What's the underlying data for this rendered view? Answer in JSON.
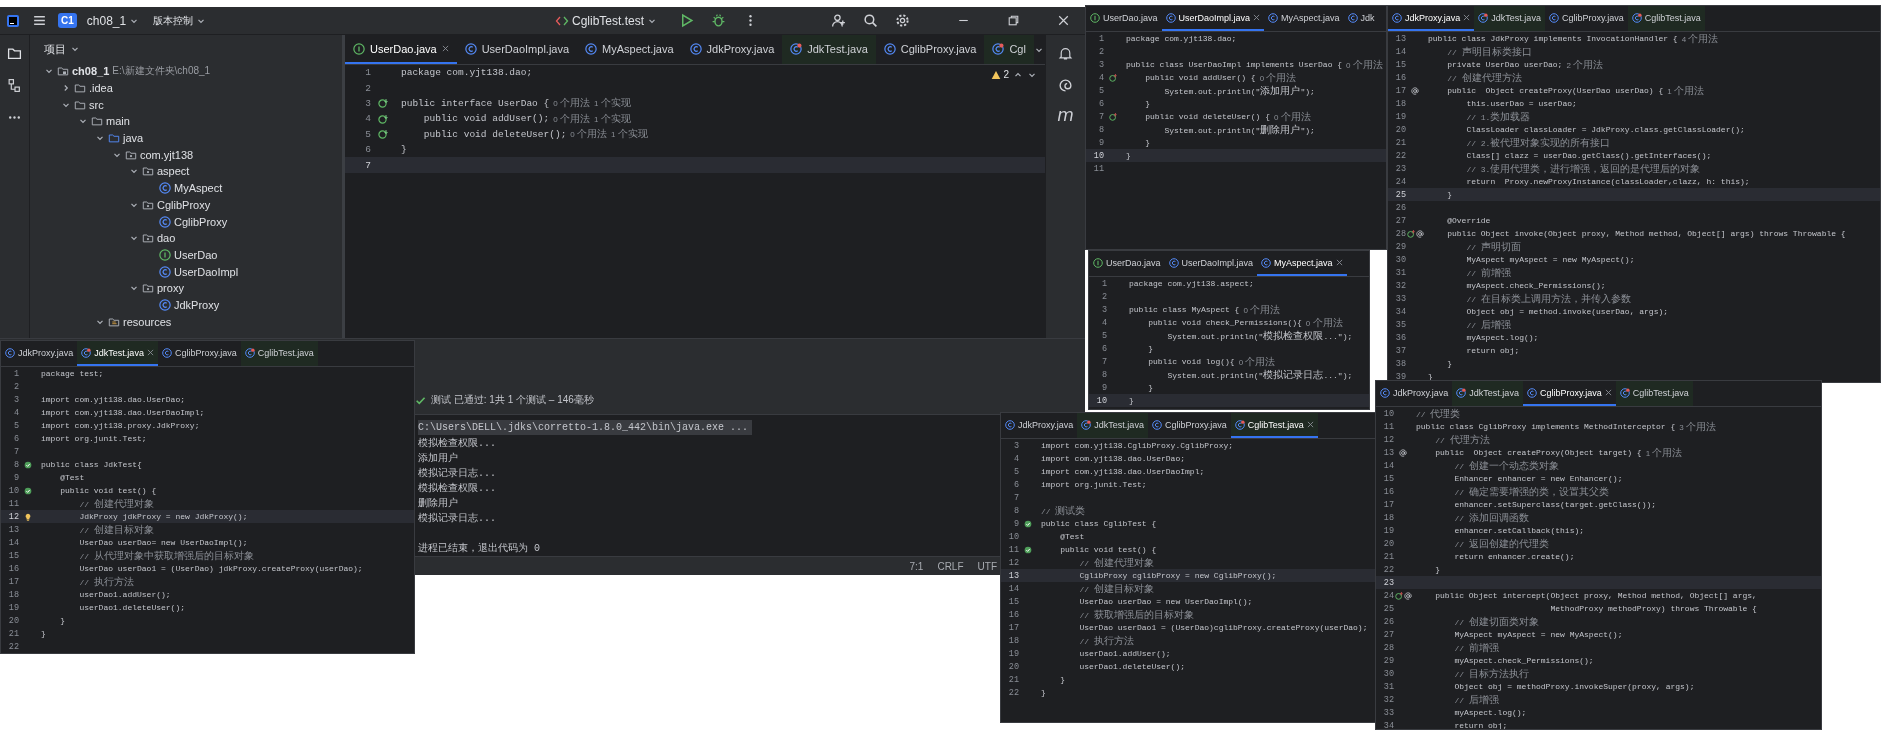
{
  "main_window": {
    "title_bar": {
      "project_badge": "C1",
      "project": "ch08_1",
      "vcs": "版本控制",
      "run_config": "CglibTest.test"
    },
    "project_panel": {
      "title": "项目",
      "tree": [
        {
          "label": "ch08_1",
          "path": "E:\\新建文件夹\\ch08_1",
          "kind": "module",
          "expanded": true,
          "children": [
            {
              "label": ".idea",
              "kind": "folder",
              "expanded": false
            },
            {
              "label": "src",
              "kind": "folder",
              "expanded": true,
              "children": [
                {
                  "label": "main",
                  "kind": "folder",
                  "expanded": true,
                  "children": [
                    {
                      "label": "java",
                      "kind": "source",
                      "expanded": true,
                      "children": [
                        {
                          "label": "com.yjt138",
                          "kind": "package",
                          "expanded": true,
                          "children": [
                            {
                              "label": "aspect",
                              "kind": "package",
                              "expanded": true,
                              "children": [
                                {
                                  "label": "MyAspect",
                                  "kind": "class"
                                }
                              ]
                            },
                            {
                              "label": "CglibProxy",
                              "kind": "package",
                              "expanded": true,
                              "children": [
                                {
                                  "label": "CglibProxy",
                                  "kind": "class"
                                }
                              ]
                            },
                            {
                              "label": "dao",
                              "kind": "package",
                              "expanded": true,
                              "children": [
                                {
                                  "label": "UserDao",
                                  "kind": "interface"
                                },
                                {
                                  "label": "UserDaoImpl",
                                  "kind": "class"
                                }
                              ]
                            },
                            {
                              "label": "proxy",
                              "kind": "package",
                              "expanded": true,
                              "children": [
                                {
                                  "label": "JdkProxy",
                                  "kind": "class"
                                }
                              ]
                            }
                          ]
                        }
                      ]
                    },
                    {
                      "label": "resources",
                      "kind": "resources",
                      "expanded": true
                    }
                  ]
                }
              ]
            }
          ]
        }
      ]
    },
    "editor": {
      "warnings": "2",
      "tabs": [
        {
          "label": "UserDao.java",
          "kind": "interface",
          "selected": true
        },
        {
          "label": "UserDaoImpl.java",
          "kind": "class",
          "selected": false
        },
        {
          "label": "MyAspect.java",
          "kind": "class",
          "selected": false
        },
        {
          "label": "JdkProxy.java",
          "kind": "class",
          "selected": false
        },
        {
          "label": "JdkTest.java",
          "kind": "test",
          "selected": false
        },
        {
          "label": "CglibProxy.java",
          "kind": "class",
          "selected": false
        },
        {
          "label": "Cgl",
          "kind": "test",
          "selected": false
        }
      ],
      "lines": [
        {
          "n": "1",
          "kind": "code",
          "code": "package com.yjt138.dao;",
          "selected": false
        },
        {
          "n": "2",
          "kind": "code",
          "selected": false
        },
        {
          "n": "3",
          "kind": "code",
          "code": "public interface UserDao {",
          "hints": [
            "0 个用法",
            "1 个实现"
          ],
          "gutter": [
            {
              "kind": "impl"
            }
          ],
          "selected": false
        },
        {
          "n": "4",
          "kind": "code",
          "code": "    public void addUser();",
          "hints": [
            "0 个用法",
            "1 个实现"
          ],
          "gutter": [
            {
              "kind": "impl"
            }
          ],
          "selected": false
        },
        {
          "n": "5",
          "kind": "code",
          "code": "    public void deleteUser();",
          "hints": [
            "0 个用法",
            "1 个实现"
          ],
          "gutter": [
            {
              "kind": "impl"
            }
          ],
          "selected": false
        },
        {
          "n": "6",
          "kind": "code",
          "code": "}",
          "selected": false
        },
        {
          "n": "7",
          "kind": "code",
          "selected": true
        }
      ]
    },
    "right_stripe": {
      "maven": "m"
    },
    "run_panel": {
      "status": "测试 已通过: 1共 1 个测试 – 146毫秒",
      "output": [
        {
          "kind": "command",
          "text": "C:\\Users\\DELL\\.jdks\\corretto-1.8.0_442\\bin\\java.exe ..."
        },
        {
          "kind": "output",
          "text": "模拟检查权限..."
        },
        {
          "kind": "output",
          "text": "添加用户"
        },
        {
          "kind": "output",
          "text": "模拟记录日志..."
        },
        {
          "kind": "output",
          "text": "模拟检查权限..."
        },
        {
          "kind": "output",
          "text": "删除用户"
        },
        {
          "kind": "output",
          "text": "模拟记录日志..."
        }
      ],
      "exit_message": "进程已结束，退出代码为 0"
    },
    "status_bar": [
      "7:1",
      "CRLF",
      "UTF"
    ]
  },
  "editor_windows": [
    {
      "tabs": [
        {
          "label": "JdkProxy.java",
          "kind": "class",
          "selected": false
        },
        {
          "label": "JdkTest.java",
          "kind": "test",
          "selected": true
        },
        {
          "label": "CglibProxy.java",
          "kind": "class",
          "selected": false
        },
        {
          "label": "CglibTest.java",
          "kind": "test",
          "selected": false
        }
      ],
      "lines": [
        {
          "n": "1",
          "kind": "code",
          "code": "package test;",
          "selected": false
        },
        {
          "n": "2",
          "kind": "code",
          "selected": false
        },
        {
          "n": "3",
          "kind": "code",
          "code": "import com.yjt138.dao.UserDao;",
          "selected": false
        },
        {
          "n": "4",
          "kind": "code",
          "code": "import com.yjt138.dao.UserDaoImpl;",
          "selected": false
        },
        {
          "n": "5",
          "kind": "code",
          "code": "import com.yjt138.proxy.JdkProxy;",
          "selected": false
        },
        {
          "n": "6",
          "kind": "code",
          "code": "import org.junit.Test;",
          "selected": false
        },
        {
          "n": "7",
          "kind": "code",
          "selected": false
        },
        {
          "n": "8",
          "kind": "code",
          "code": "public class JdkTest{",
          "gutter": [
            {
              "kind": "run"
            }
          ],
          "selected": false
        },
        {
          "n": "9",
          "kind": "code",
          "code": "    @Test",
          "selected": false
        },
        {
          "n": "10",
          "kind": "code",
          "code": "    public void test() {",
          "gutter": [
            {
              "kind": "run"
            }
          ],
          "selected": false
        },
        {
          "n": "11",
          "kind": "comment",
          "code": "        // 创建代理对象",
          "selected": false
        },
        {
          "n": "12",
          "kind": "code",
          "code": "        JdkProxy jdkProxy = new JdkProxy();",
          "gutter": [
            {
              "kind": "bulb"
            }
          ],
          "selected": true
        },
        {
          "n": "13",
          "kind": "comment",
          "code": "        // 创建目标对象",
          "selected": false
        },
        {
          "n": "14",
          "kind": "code",
          "code": "        UserDao userDao= new UserDaoImpl();",
          "selected": false
        },
        {
          "n": "15",
          "kind": "comment",
          "code": "        // 从代理对象中获取增强后的目标对象",
          "selected": false
        },
        {
          "n": "16",
          "kind": "code",
          "code": "        UserDao userDao1 = (UserDao) jdkProxy.createProxy(userDao);",
          "selected": false
        },
        {
          "n": "17",
          "kind": "comment",
          "code": "        // 执行方法",
          "selected": false
        },
        {
          "n": "18",
          "kind": "code",
          "code": "        userDao1.addUser();",
          "selected": false
        },
        {
          "n": "19",
          "kind": "code",
          "code": "        userDao1.deleteUser();",
          "selected": false
        },
        {
          "n": "20",
          "kind": "code",
          "code": "    }",
          "selected": false
        },
        {
          "n": "21",
          "kind": "code",
          "code": "}",
          "selected": false
        },
        {
          "n": "22",
          "kind": "code",
          "selected": false
        }
      ]
    },
    {
      "tabs": [
        {
          "label": "UserDao.java",
          "kind": "interface",
          "selected": false
        },
        {
          "label": "UserDaoImpl.java",
          "kind": "class",
          "selected": true
        },
        {
          "label": "MyAspect.java",
          "kind": "class",
          "selected": false
        },
        {
          "label": "Jdk",
          "kind": "class",
          "selected": false
        }
      ],
      "lines": [
        {
          "n": "1",
          "kind": "code",
          "code": "package com.yjt138.dao;",
          "selected": false
        },
        {
          "n": "2",
          "kind": "code",
          "selected": false
        },
        {
          "n": "3",
          "kind": "code",
          "code": "public class UserDaoImpl implements UserDao {",
          "hints": [
            "0 个用法"
          ],
          "selected": false
        },
        {
          "n": "4",
          "kind": "code",
          "code": "    public void addUser() {",
          "hints": [
            "0 个用法"
          ],
          "gutter": [
            {
              "kind": "override"
            }
          ],
          "selected": false
        },
        {
          "n": "5",
          "kind": "code",
          "code": "        System.out.println(\"添加用户\");",
          "selected": false
        },
        {
          "n": "6",
          "kind": "code",
          "code": "    }",
          "selected": false
        },
        {
          "n": "7",
          "kind": "code",
          "code": "    public void deleteUser() {",
          "hints": [
            "0 个用法"
          ],
          "gutter": [
            {
              "kind": "override"
            }
          ],
          "selected": false
        },
        {
          "n": "8",
          "kind": "code",
          "code": "        System.out.println(\"删除用户\");",
          "selected": false
        },
        {
          "n": "9",
          "kind": "code",
          "code": "    }",
          "selected": false
        },
        {
          "n": "10",
          "kind": "code",
          "code": "}",
          "selected": true
        },
        {
          "n": "11",
          "kind": "code",
          "selected": false
        }
      ]
    },
    {
      "tabs": [
        {
          "label": "UserDao.java",
          "kind": "interface",
          "selected": false
        },
        {
          "label": "UserDaoImpl.java",
          "kind": "class",
          "selected": false
        },
        {
          "label": "MyAspect.java",
          "kind": "class",
          "selected": true
        }
      ],
      "lines": [
        {
          "n": "1",
          "kind": "code",
          "code": "package com.yjt138.aspect;",
          "selected": false
        },
        {
          "n": "2",
          "kind": "code",
          "selected": false
        },
        {
          "n": "3",
          "kind": "code",
          "code": "public class MyAspect {",
          "hints": [
            "0 个用法"
          ],
          "selected": false
        },
        {
          "n": "4",
          "kind": "code",
          "code": "    public void check_Permissions(){",
          "hints": [
            "0 个用法"
          ],
          "selected": false
        },
        {
          "n": "5",
          "kind": "code",
          "code": "        System.out.println(\"模拟检查权限...\");",
          "selected": false
        },
        {
          "n": "6",
          "kind": "code",
          "code": "    }",
          "selected": false
        },
        {
          "n": "7",
          "kind": "code",
          "code": "    public void log(){",
          "hints": [
            "0 个用法"
          ],
          "selected": false
        },
        {
          "n": "8",
          "kind": "code",
          "code": "        System.out.println(\"模拟记录日志...\");",
          "selected": false
        },
        {
          "n": "9",
          "kind": "code",
          "code": "    }",
          "selected": false
        },
        {
          "n": "10",
          "kind": "code",
          "code": "}",
          "selected": true
        }
      ]
    },
    {
      "tabs": [
        {
          "label": "JdkProxy.java",
          "kind": "class",
          "selected": true
        },
        {
          "label": "JdkTest.java",
          "kind": "test",
          "selected": false
        },
        {
          "label": "CglibProxy.java",
          "kind": "class",
          "selected": false
        },
        {
          "label": "CglibTest.java",
          "kind": "test",
          "selected": false
        }
      ],
      "lines": [
        {
          "n": "13",
          "kind": "code",
          "code": "public class JdkProxy implements InvocationHandler {",
          "hints": [
            "4 个用法"
          ],
          "selected": false
        },
        {
          "n": "14",
          "kind": "comment",
          "code": "    // 声明目标类接口",
          "selected": false
        },
        {
          "n": "15",
          "kind": "code",
          "code": "    private UserDao userDao;",
          "hints": [
            "2 个用法"
          ],
          "selected": false
        },
        {
          "n": "16",
          "kind": "comment",
          "code": "    // 创建代理方法",
          "selected": false
        },
        {
          "n": "17",
          "kind": "code",
          "code": "    public  Object createProxy(UserDao userDao) {",
          "hints": [
            "1 个用法"
          ],
          "gutter": [
            {
              "kind": "at"
            }
          ],
          "selected": false
        },
        {
          "n": "18",
          "kind": "code",
          "code": "        this.userDao = userDao;",
          "selected": false
        },
        {
          "n": "19",
          "kind": "comment",
          "code": "        // 1.类加载器",
          "selected": false
        },
        {
          "n": "20",
          "kind": "code",
          "code": "        ClassLoader classLoader = JdkProxy.class.getClassLoader();",
          "selected": false
        },
        {
          "n": "21",
          "kind": "comment",
          "code": "        // 2.被代理对象实现的所有接口",
          "selected": false
        },
        {
          "n": "22",
          "kind": "code",
          "code": "        Class[] clazz = userDao.getClass().getInterfaces();",
          "selected": false
        },
        {
          "n": "23",
          "kind": "comment",
          "code": "        // 3.使用代理类，进行增强，返回的是代理后的对象",
          "selected": false
        },
        {
          "n": "24",
          "kind": "code",
          "code": "        return  Proxy.newProxyInstance(classLoader,clazz, h: this);",
          "selected": false
        },
        {
          "n": "25",
          "kind": "code",
          "code": "    }",
          "selected": true
        },
        {
          "n": "26",
          "kind": "code",
          "selected": false
        },
        {
          "n": "27",
          "kind": "code",
          "code": "    @Override",
          "selected": false
        },
        {
          "n": "28",
          "kind": "code",
          "code": "    public Object invoke(Object proxy, Method method, Object[] args) throws Throwable {",
          "gutter": [
            {
              "kind": "override"
            },
            {
              "kind": "at"
            }
          ],
          "selected": false
        },
        {
          "n": "29",
          "kind": "comment",
          "code": "        // 声明切面",
          "selected": false
        },
        {
          "n": "30",
          "kind": "code",
          "code": "        MyAspect myAspect = new MyAspect();",
          "selected": false
        },
        {
          "n": "31",
          "kind": "comment",
          "code": "        // 前增强",
          "selected": false
        },
        {
          "n": "32",
          "kind": "code",
          "code": "        myAspect.check_Permissions();",
          "selected": false
        },
        {
          "n": "33",
          "kind": "comment",
          "code": "        // 在目标类上调用方法，并传入参数",
          "selected": false
        },
        {
          "n": "34",
          "kind": "code",
          "code": "        Object obj = method.invoke(userDao, args);",
          "selected": false
        },
        {
          "n": "35",
          "kind": "comment",
          "code": "        // 后增强",
          "selected": false
        },
        {
          "n": "36",
          "kind": "code",
          "code": "        myAspect.log();",
          "selected": false
        },
        {
          "n": "37",
          "kind": "code",
          "code": "        return obj;",
          "selected": false
        },
        {
          "n": "38",
          "kind": "code",
          "code": "    }",
          "selected": false
        },
        {
          "n": "39",
          "kind": "code",
          "code": "}",
          "selected": false
        }
      ]
    },
    {
      "tabs": [
        {
          "label": "JdkProxy.java",
          "kind": "class",
          "selected": false
        },
        {
          "label": "JdkTest.java",
          "kind": "test",
          "selected": false
        },
        {
          "label": "CglibProxy.java",
          "kind": "class",
          "selected": false
        },
        {
          "label": "CglibTest.java",
          "kind": "test",
          "selected": true
        }
      ],
      "lines": [
        {
          "n": "3",
          "kind": "code",
          "code": "import com.yjt138.CglibProxy.CglibProxy;",
          "selected": false
        },
        {
          "n": "4",
          "kind": "code",
          "code": "import com.yjt138.dao.UserDao;",
          "selected": false
        },
        {
          "n": "5",
          "kind": "code",
          "code": "import com.yjt138.dao.UserDaoImpl;",
          "selected": false
        },
        {
          "n": "6",
          "kind": "code",
          "code": "import org.junit.Test;",
          "selected": false
        },
        {
          "n": "7",
          "kind": "code",
          "selected": false
        },
        {
          "n": "8",
          "kind": "comment",
          "code": "// 测试类",
          "selected": false
        },
        {
          "n": "9",
          "kind": "code",
          "code": "public class CglibTest {",
          "gutter": [
            {
              "kind": "run"
            }
          ],
          "selected": false
        },
        {
          "n": "10",
          "kind": "code",
          "code": "    @Test",
          "selected": false
        },
        {
          "n": "11",
          "kind": "code",
          "code": "    public void test() {",
          "gutter": [
            {
              "kind": "run"
            }
          ],
          "selected": false
        },
        {
          "n": "12",
          "kind": "comment",
          "code": "        // 创建代理对象",
          "selected": false
        },
        {
          "n": "13",
          "kind": "code",
          "code": "        CglibProxy cglibProxy = new CglibProxy();",
          "selected": true
        },
        {
          "n": "14",
          "kind": "comment",
          "code": "        // 创建目标对象",
          "selected": false
        },
        {
          "n": "15",
          "kind": "code",
          "code": "        UserDao userDao = new UserDaoImpl();",
          "selected": false
        },
        {
          "n": "16",
          "kind": "comment",
          "code": "        // 获取增强后的目标对象",
          "selected": false
        },
        {
          "n": "17",
          "kind": "code",
          "code": "        UserDao userDao1 = (UserDao)cglibProxy.createProxy(userDao);",
          "selected": false
        },
        {
          "n": "18",
          "kind": "comment",
          "code": "        // 执行方法",
          "selected": false
        },
        {
          "n": "19",
          "kind": "code",
          "code": "        userDao1.addUser();",
          "selected": false
        },
        {
          "n": "20",
          "kind": "code",
          "code": "        userDao1.deleteUser();",
          "selected": false
        },
        {
          "n": "21",
          "kind": "code",
          "code": "    }",
          "selected": false
        },
        {
          "n": "22",
          "kind": "code",
          "code": "}",
          "selected": false
        }
      ]
    },
    {
      "tabs": [
        {
          "label": "JdkProxy.java",
          "kind": "class",
          "selected": false
        },
        {
          "label": "JdkTest.java",
          "kind": "test",
          "selected": false
        },
        {
          "label": "CglibProxy.java",
          "kind": "class",
          "selected": true
        },
        {
          "label": "CglibTest.java",
          "kind": "test",
          "selected": false
        }
      ],
      "lines": [
        {
          "n": "10",
          "kind": "comment",
          "code": "// 代理类",
          "selected": false
        },
        {
          "n": "11",
          "kind": "code",
          "code": "public class CglibProxy implements MethodInterceptor {",
          "hints": [
            "3 个用法"
          ],
          "selected": false
        },
        {
          "n": "12",
          "kind": "comment",
          "code": "    // 代理方法",
          "selected": false
        },
        {
          "n": "13",
          "kind": "code",
          "code": "    public  Object createProxy(Object target) {",
          "hints": [
            "1 个用法"
          ],
          "gutter": [
            {
              "kind": "at"
            }
          ],
          "selected": false
        },
        {
          "n": "14",
          "kind": "comment",
          "code": "        // 创建一个动态类对象",
          "selected": false
        },
        {
          "n": "15",
          "kind": "code",
          "code": "        Enhancer enhancer = new Enhancer();",
          "selected": false
        },
        {
          "n": "16",
          "kind": "comment",
          "code": "        // 确定需要增强的类，设置其父类",
          "selected": false
        },
        {
          "n": "17",
          "kind": "code",
          "code": "        enhancer.setSuperclass(target.getClass());",
          "selected": false
        },
        {
          "n": "18",
          "kind": "comment",
          "code": "        // 添加回调函数",
          "selected": false
        },
        {
          "n": "19",
          "kind": "code",
          "code": "        enhancer.setCallback(this);",
          "selected": false
        },
        {
          "n": "20",
          "kind": "comment",
          "code": "        // 返回创建的代理类",
          "selected": false
        },
        {
          "n": "21",
          "kind": "code",
          "code": "        return enhancer.create();",
          "selected": false
        },
        {
          "n": "22",
          "kind": "code",
          "code": "    }",
          "selected": false
        },
        {
          "n": "23",
          "kind": "code",
          "selected": true
        },
        {
          "n": "24",
          "kind": "code",
          "code": "    public Object intercept(Object proxy, Method method, Object[] args,",
          "gutter": [
            {
              "kind": "override"
            },
            {
              "kind": "at"
            }
          ],
          "selected": false
        },
        {
          "n": "25",
          "kind": "code",
          "code": "                            MethodProxy methodProxy) throws Throwable {",
          "selected": false
        },
        {
          "n": "26",
          "kind": "comment",
          "code": "        // 创建切面类对象",
          "selected": false
        },
        {
          "n": "27",
          "kind": "code",
          "code": "        MyAspect myAspect = new MyAspect();",
          "selected": false
        },
        {
          "n": "28",
          "kind": "comment",
          "code": "        // 前增强",
          "selected": false
        },
        {
          "n": "29",
          "kind": "code",
          "code": "        myAspect.check_Permissions();",
          "selected": false
        },
        {
          "n": "30",
          "kind": "comment",
          "code": "        // 目标方法执行",
          "selected": false
        },
        {
          "n": "31",
          "kind": "code",
          "code": "        Object obj = methodProxy.invokeSuper(proxy, args);",
          "selected": false
        },
        {
          "n": "32",
          "kind": "comment",
          "code": "        // 后增强",
          "selected": false
        },
        {
          "n": "33",
          "kind": "code",
          "code": "        myAspect.log();",
          "selected": false
        },
        {
          "n": "34",
          "kind": "code",
          "code": "        return obj;",
          "selected": false
        }
      ]
    }
  ]
}
